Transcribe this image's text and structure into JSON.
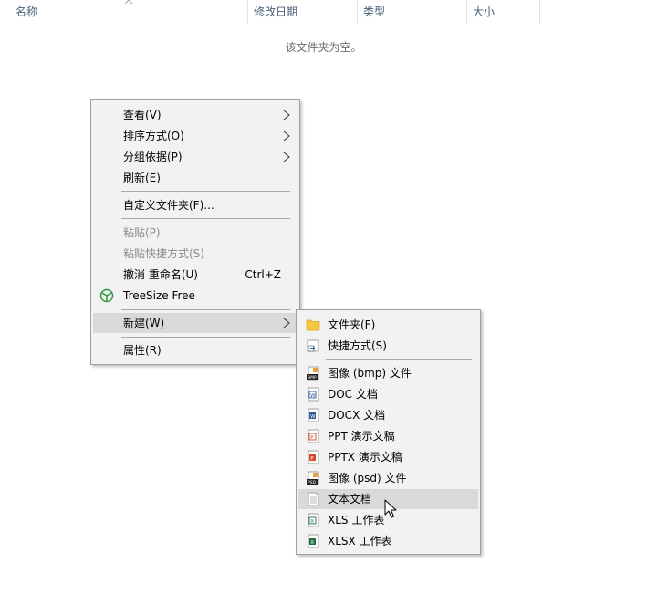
{
  "columns": {
    "name": "名称",
    "date": "修改日期",
    "type": "类型",
    "size": "大小"
  },
  "empty_message": "该文件夹为空。",
  "context_menu": {
    "view": "查看(V)",
    "sort": "排序方式(O)",
    "group": "分组依据(P)",
    "refresh": "刷新(E)",
    "customize": "自定义文件夹(F)...",
    "paste": "粘贴(P)",
    "paste_shortcut": "粘贴快捷方式(S)",
    "undo": "撤消 重命名(U)",
    "undo_shortcut": "Ctrl+Z",
    "treesize": "TreeSize Free",
    "new": "新建(W)",
    "properties": "属性(R)"
  },
  "new_submenu": {
    "folder": "文件夹(F)",
    "shortcut": "快捷方式(S)",
    "bmp": "图像 (bmp) 文件",
    "doc": "DOC 文档",
    "docx": "DOCX 文档",
    "ppt": "PPT 演示文稿",
    "pptx": "PPTX 演示文稿",
    "psd": "图像 (psd) 文件",
    "txt": "文本文档",
    "xls": "XLS 工作表",
    "xlsx": "XLSX 工作表"
  },
  "colors": {
    "menu_bg": "#f2f2f2",
    "highlight": "#d9d9d9",
    "header_text": "#4c607a",
    "treesize_green": "#2e9b3d",
    "folder_yellow": "#f5c842",
    "word_blue": "#2b5797",
    "ppt_orange": "#d24726",
    "excel_green": "#1e7145"
  }
}
